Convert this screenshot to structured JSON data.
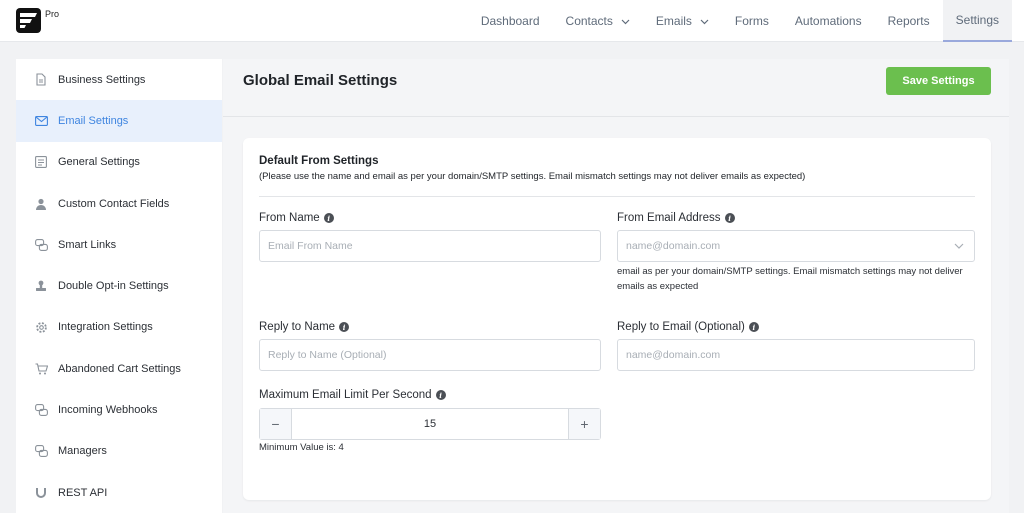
{
  "header": {
    "badge": "Pro",
    "nav": [
      {
        "label": "Dashboard",
        "dropdown": false,
        "active": false
      },
      {
        "label": "Contacts",
        "dropdown": true,
        "active": false
      },
      {
        "label": "Emails",
        "dropdown": true,
        "active": false
      },
      {
        "label": "Forms",
        "dropdown": false,
        "active": false
      },
      {
        "label": "Automations",
        "dropdown": false,
        "active": false
      },
      {
        "label": "Reports",
        "dropdown": false,
        "active": false
      },
      {
        "label": "Settings",
        "dropdown": false,
        "active": true
      }
    ]
  },
  "sidebar": {
    "items": [
      {
        "label": "Business Settings",
        "icon": "document-icon",
        "active": false
      },
      {
        "label": "Email Settings",
        "icon": "envelope-icon",
        "active": true
      },
      {
        "label": "General Settings",
        "icon": "settings-sliders-icon",
        "active": false
      },
      {
        "label": "Custom Contact Fields",
        "icon": "user-icon",
        "active": false
      },
      {
        "label": "Smart Links",
        "icon": "link-icon",
        "active": false
      },
      {
        "label": "Double Opt-in Settings",
        "icon": "stamp-icon",
        "active": false
      },
      {
        "label": "Integration Settings",
        "icon": "gear-icon",
        "active": false
      },
      {
        "label": "Abandoned Cart Settings",
        "icon": "cart-icon",
        "active": false
      },
      {
        "label": "Incoming Webhooks",
        "icon": "webhook-icon",
        "active": false
      },
      {
        "label": "Managers",
        "icon": "managers-icon",
        "active": false
      },
      {
        "label": "REST API",
        "icon": "magnet-icon",
        "active": false
      }
    ]
  },
  "main": {
    "title": "Global Email Settings",
    "save_label": "Save Settings",
    "section_title": "Default From Settings",
    "section_note": "(Please use the name and email as per your domain/SMTP settings. Email mismatch settings may not deliver emails as expected)",
    "from_name": {
      "label": "From Name",
      "placeholder": "Email From Name",
      "value": ""
    },
    "from_email": {
      "label": "From Email Address",
      "placeholder": "name@domain.com",
      "help": "email as per your domain/SMTP settings. Email mismatch settings may not deliver emails as expected"
    },
    "reply_name": {
      "label": "Reply to Name",
      "placeholder": "Reply to Name (Optional)"
    },
    "reply_email": {
      "label": "Reply to Email (Optional)",
      "placeholder": "name@domain.com"
    },
    "limit": {
      "label": "Maximum Email Limit Per Second",
      "value": "15",
      "help": "Minimum Value is: 4",
      "minus": "−",
      "plus": "+"
    }
  },
  "colors": {
    "accent": "#3f85e0",
    "save_button": "#6bbf4e",
    "active_sidebar_bg": "#e8f0fc"
  }
}
